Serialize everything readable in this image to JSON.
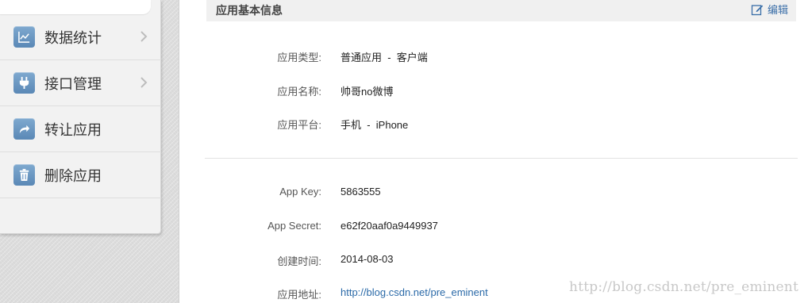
{
  "sidebar": {
    "items": [
      {
        "label": "数据统计",
        "icon": "line-chart-icon",
        "has_chevron": true
      },
      {
        "label": "接口管理",
        "icon": "plug-icon",
        "has_chevron": true
      },
      {
        "label": "转让应用",
        "icon": "share-arrow-icon",
        "has_chevron": false
      },
      {
        "label": "删除应用",
        "icon": "trash-icon",
        "has_chevron": false
      }
    ]
  },
  "section": {
    "title": "应用基本信息",
    "edit_label": "编辑",
    "edit_icon": "edit-icon"
  },
  "info": {
    "app_type_label": "应用类型:",
    "app_type_value": "普通应用  -  客户端",
    "app_name_label": "应用名称:",
    "app_name_value": "帅哥no微博",
    "platform_label": "应用平台:",
    "platform_value": "手机  -  iPhone",
    "app_key_label": "App Key:",
    "app_key_value": "5863555",
    "app_secret_label": "App Secret:",
    "app_secret_value": "e62f20aaf0a9449937",
    "created_label": "创建时间:",
    "created_value": "2014-08-03",
    "url_label": "应用地址:",
    "url_value": "http://blog.csdn.net/pre_eminent"
  },
  "watermark": "http://blog.csdn.net/pre_eminent",
  "colors": {
    "icon_blue": "#6b97c4",
    "link_blue": "#2b6aa8",
    "header_bg": "#f0f0f0"
  }
}
